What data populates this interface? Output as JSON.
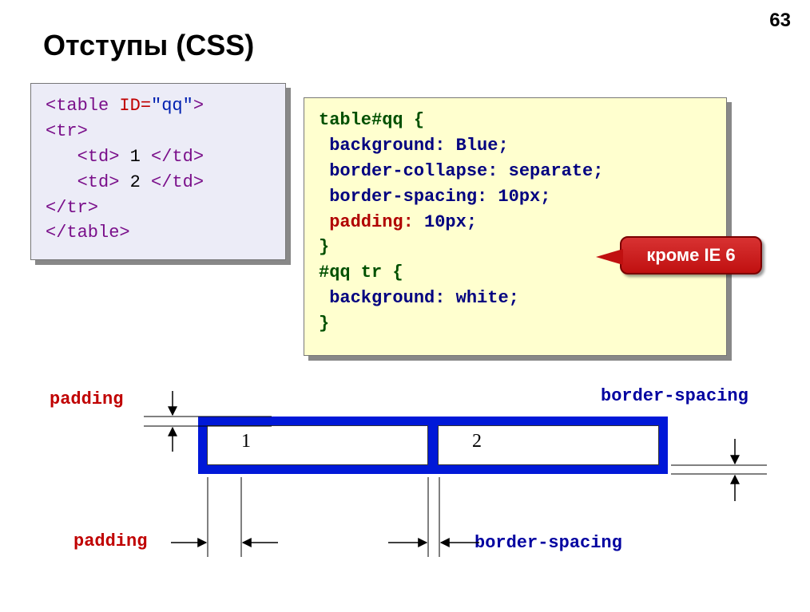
{
  "page_number": "63",
  "title": "Отступы (CSS)",
  "html_code": {
    "line1_open": "<table",
    "line1_attr": " ID=",
    "line1_val": "\"qq\"",
    "line1_close": ">",
    "line2": "<tr>",
    "line3_open": "   <td>",
    "line3_text": " 1 ",
    "line3_close": "</td>",
    "line4_open": "   <td>",
    "line4_text": " 2 ",
    "line4_close": "</td>",
    "line5": "</tr>",
    "line6": "</table>"
  },
  "css_code": {
    "sel1": "table#qq {",
    "p1": " background:",
    "v1": " Blue;",
    "p2": " border-collapse:",
    "v2": " separate;",
    "p3": " border-spacing:",
    "v3": " 10px;",
    "p4": " padding:",
    "v4": " 10px;",
    "close1": "}",
    "sel2": "#qq tr {",
    "p5": " background:",
    "v5": " white;",
    "close2": "}"
  },
  "callout": "кроме IE 6",
  "labels": {
    "padding": "padding",
    "border_spacing": "border-spacing"
  },
  "table_demo": {
    "cell1": "1",
    "cell2": "2"
  }
}
